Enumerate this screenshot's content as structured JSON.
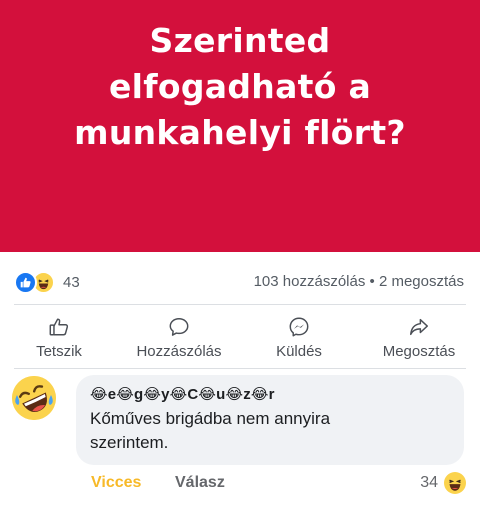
{
  "post": {
    "banner_color": "#d3103c",
    "banner_text_lines": [
      "Szerinted",
      "elfogadható a",
      "munkahelyi flört?"
    ]
  },
  "stats": {
    "reaction_icons": [
      "like-icon",
      "haha-icon"
    ],
    "reaction_count": "43",
    "comments": "103 hozzászólás",
    "separator": "•",
    "shares": "2 megosztás"
  },
  "actions": [
    {
      "label": "Tetszik",
      "icon": "thumbs-up-icon"
    },
    {
      "label": "Hozzászólás",
      "icon": "comment-icon"
    },
    {
      "label": "Küldés",
      "icon": "messenger-icon"
    },
    {
      "label": "Megosztás",
      "icon": "share-icon"
    }
  ],
  "comment": {
    "avatar_icon": "laughing-emoji-icon",
    "author": "😂e😂g😂y😂C😂u😂z😂r",
    "text_lines": [
      "Kőműves brigádba nem annyira",
      "szerintem."
    ],
    "reaction_label": "Vicces",
    "reply_label": "Válasz",
    "reaction_count": "34",
    "reaction_icon": "haha-icon"
  }
}
